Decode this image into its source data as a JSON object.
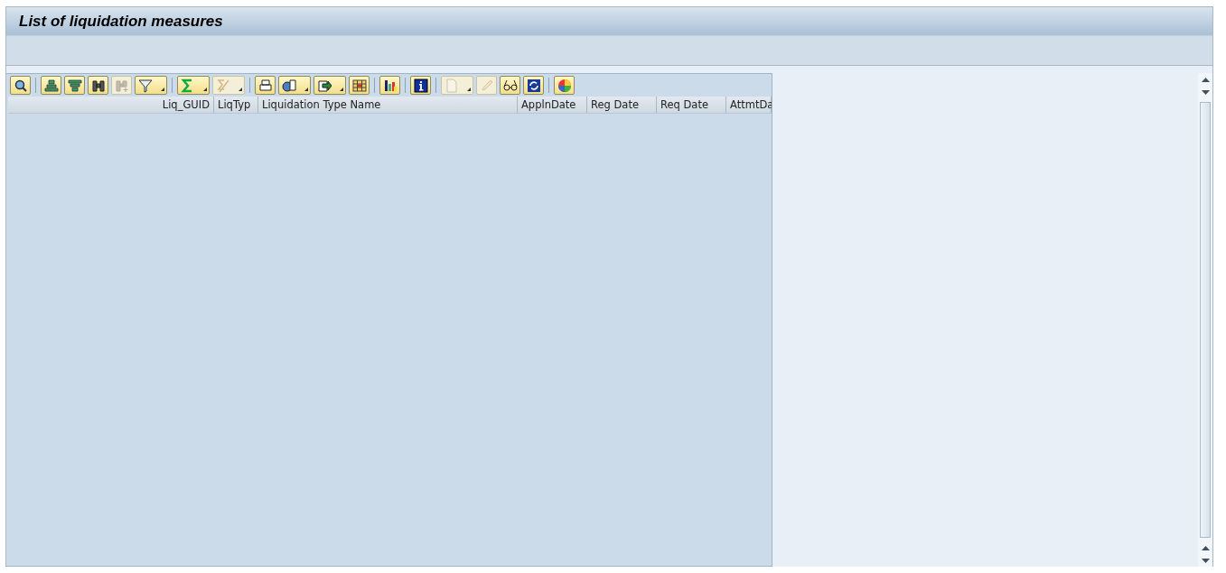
{
  "window": {
    "title": "List of liquidation measures"
  },
  "toolbar": [
    {
      "kind": "plain",
      "disabled": false
    },
    {
      "kind": "separator"
    },
    {
      "kind": "plain",
      "disabled": false
    },
    {
      "kind": "plain",
      "disabled": false
    },
    {
      "kind": "plain",
      "disabled": false
    },
    {
      "kind": "plain",
      "disabled": true
    },
    {
      "kind": "menu",
      "disabled": false
    },
    {
      "kind": "separator"
    },
    {
      "kind": "menu",
      "disabled": false
    },
    {
      "kind": "menu",
      "disabled": true
    },
    {
      "kind": "separator"
    },
    {
      "kind": "plain",
      "disabled": false
    },
    {
      "kind": "menu",
      "disabled": false
    },
    {
      "kind": "menu",
      "disabled": false
    },
    {
      "kind": "plain",
      "disabled": false
    },
    {
      "kind": "separator"
    },
    {
      "kind": "plain",
      "disabled": false
    },
    {
      "kind": "separator"
    },
    {
      "kind": "plain",
      "disabled": false
    },
    {
      "kind": "separator"
    },
    {
      "kind": "menu",
      "disabled": true
    },
    {
      "kind": "plain",
      "disabled": true
    },
    {
      "kind": "plain",
      "disabled": false
    },
    {
      "kind": "plain",
      "disabled": false
    },
    {
      "kind": "separator"
    },
    {
      "kind": "plain",
      "disabled": false
    }
  ],
  "table": {
    "columns": [
      {
        "label": "Liq_GUID"
      },
      {
        "label": "LiqTyp"
      },
      {
        "label": "Liquidation Type Name"
      },
      {
        "label": "ApplnDate"
      },
      {
        "label": "Reg Date"
      },
      {
        "label": "Req Date"
      },
      {
        "label": "AttmtDa"
      }
    ]
  }
}
